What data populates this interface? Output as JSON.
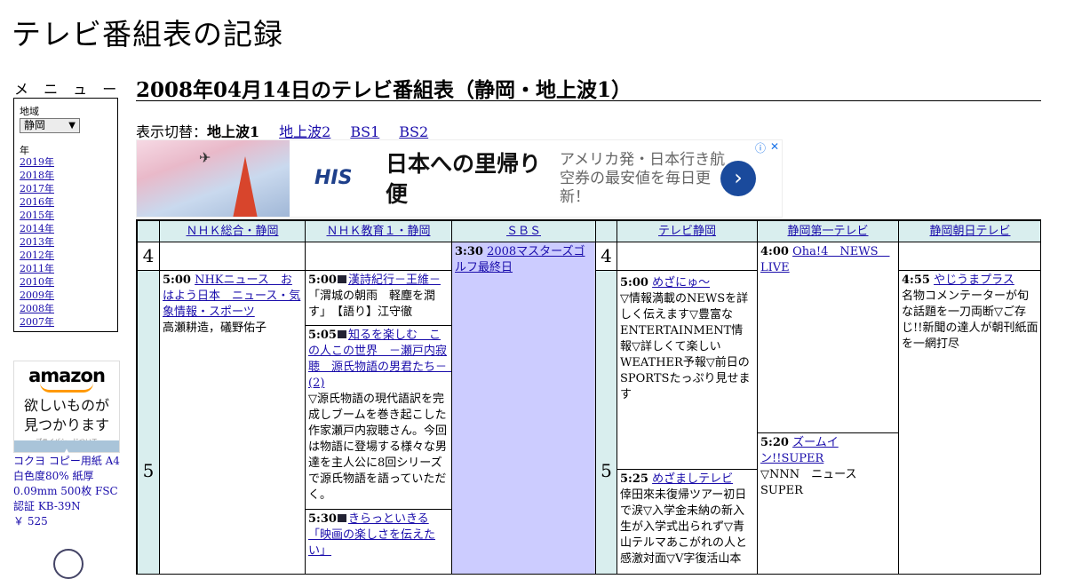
{
  "site": {
    "title": "テレビ番組表の記録"
  },
  "sidebar": {
    "menu_label": "メ ニ ュ ー",
    "region_label": "地域",
    "region_value": "静岡",
    "year_label": "年",
    "years": [
      "2019年",
      "2018年",
      "2017年",
      "2016年",
      "2015年",
      "2014年",
      "2013年",
      "2012年",
      "2011年",
      "2010年",
      "2009年",
      "2008年",
      "2007年"
    ]
  },
  "amazon_ad": {
    "logo": "amazon",
    "tagline_1": "欲しいものが",
    "tagline_2": "見つかります",
    "privacy": "プライバシーについて",
    "product": "コクヨ コピー用紙 A4 白色度80% 紙厚0.09mm 500枚 FSC認証 KB-39N",
    "price": "￥ 525"
  },
  "main": {
    "heading": "2008年04月14日のテレビ番組表（静岡・地上波1）",
    "switch_label": "表示切替：",
    "switch_current": "地上波1",
    "switch_links": [
      "地上波2",
      "BS1",
      "BS2"
    ]
  },
  "banner_ad": {
    "brand": "HIS",
    "headline": "日本への里帰り便",
    "description": "アメリカ発・日本行き航空券の最安値を毎日更新！",
    "go_symbol": "›",
    "info_symbol": "ⓘ",
    "close_symbol": "✕"
  },
  "schedule": {
    "channels": [
      "ＮＨＫ総合・静岡",
      "ＮＨＫ教育１・静岡",
      "ＳＢＳ",
      "テレビ静岡",
      "静岡第一テレビ",
      "静岡朝日テレビ"
    ],
    "hours": [
      "4",
      "5"
    ],
    "programs": {
      "sbs_0330": {
        "time": "3:30",
        "title": "2008マスターズゴルフ最終日",
        "desc": ""
      },
      "sdt_0400": {
        "time": "4:00",
        "title": "Oha!4　NEWS　LIVE",
        "desc": ""
      },
      "nhk_0500": {
        "time": "5:00",
        "title": "NHKニュース　おはよう日本　ニュース・気象情報・スポーツ",
        "desc": "高瀬耕造，礒野佑子"
      },
      "etv_0500": {
        "time": "5:00",
        "title": "漢詩紀行－王維－",
        "desc": "「渭城の朝雨　軽塵を潤す」　【語り】江守徹"
      },
      "etv_0505": {
        "time": "5:05",
        "title": "知るを楽しむ　この人この世界　－瀬戸内寂聴　源氏物語の男君たち－　(2)",
        "desc": "▽源氏物語の現代語訳を完成しブームを巻き起こした作家瀬戸内寂聴さん。今回は物語に登場する様々な男達を主人公に8回シリーズで源氏物語を語っていただく。"
      },
      "etv_0530": {
        "time": "5:30",
        "title": "きらっといきる「映画の楽しさを伝えたい」",
        "desc": ""
      },
      "sut_0500": {
        "time": "5:00",
        "title": "めざにゅ～",
        "desc": "▽情報満載のNEWSを詳しく伝えます▽豊富なENTERTAINMENT情報▽詳しくて楽しいWEATHER予報▽前日のSPORTSたっぷり見せます"
      },
      "sut_0525": {
        "time": "5:25",
        "title": "めざましテレビ",
        "desc": "倖田來未復帰ツアー初日で涙▽入学金未納の新入生が入学式出られず▽青山テルマあこがれの人と感激対面▽V字復活山本"
      },
      "sdt_0520": {
        "time": "5:20",
        "title": "ズームイン!!SUPER",
        "desc": "▽NNN　ニュースSUPER"
      },
      "sat_0455": {
        "time": "4:55",
        "title": "やじうまプラス",
        "desc": "名物コメンテーターが旬な話題を一刀両断▽ご存じ!!新聞の達人が朝刊紙面を一網打尽"
      }
    }
  }
}
